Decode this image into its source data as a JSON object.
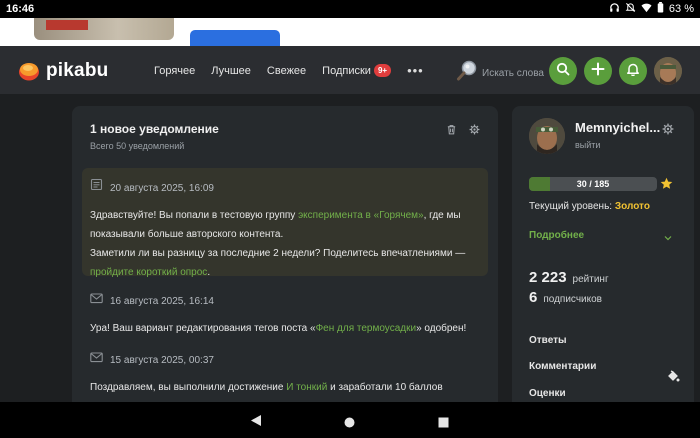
{
  "status_bar": {
    "time": "16:46",
    "battery": "63 %",
    "icons": [
      "headset-icon",
      "mute-icon",
      "wifi-icon",
      "battery-icon"
    ]
  },
  "header": {
    "logo": "pikabu",
    "nav": [
      {
        "label": "Горячее"
      },
      {
        "label": "Лучшее"
      },
      {
        "label": "Свежее"
      },
      {
        "label": "Подписки",
        "badge": "9+"
      }
    ],
    "search_placeholder": "Искать слова",
    "accent_color": "#5a9e3c"
  },
  "notifications": {
    "title": "1 новое уведомление",
    "subtitle": "Всего 50 уведомлений",
    "items": [
      {
        "date": "20 августа 2025, 16:09",
        "icon": "document-icon",
        "text1": "Здравствуйте! Вы попали в тестовую группу ",
        "link1": "эксперимента в «Горячем»",
        "text2": ", где мы показывали больше авторского контента.",
        "text3": "Заметили ли вы разницу за последние 2 недели? Поделитесь впечатлениями —",
        "link2": "пройдите короткий опрос",
        "text4": "."
      },
      {
        "date": "16 августа 2025, 16:14",
        "icon": "mail-icon",
        "text1": "Ура! Ваш вариант редактирования тегов поста «",
        "link1": "Фен для термоусадки",
        "text2": "» одобрен!"
      },
      {
        "date": "15 августа 2025, 00:37",
        "icon": "mail-icon",
        "text1": "Поздравляем, вы выполнили достижение ",
        "link1": "И тонкий",
        "text2": " и заработали 10 баллов"
      }
    ]
  },
  "profile": {
    "name": "Memnyichel...",
    "logout": "выйти",
    "progress_text": "30 / 185",
    "progress_fraction": 0.162,
    "level_label": "Текущий уровень: ",
    "level_value": "Золото",
    "more": "Подробнее",
    "rating_value": "2 223",
    "rating_label": "рейтинг",
    "subscribers_value": "6",
    "subscribers_label": "подписчиков",
    "menu": [
      "Ответы",
      "Комментарии",
      "Оценки"
    ]
  }
}
